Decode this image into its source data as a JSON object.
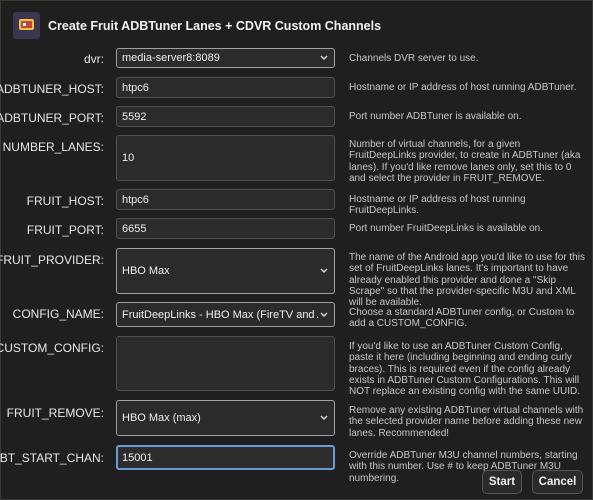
{
  "window": {
    "title": "Create Fruit ADBTuner Lanes + CDVR Custom Channels"
  },
  "fields": [
    {
      "label": "dvr:",
      "value": "media-server8:8089",
      "type": "select",
      "desc": "Channels DVR server to use."
    },
    {
      "label": "ADBTUNER_HOST:",
      "value": "htpc6",
      "type": "text",
      "desc": "Hostname or IP address of host running ADBTuner."
    },
    {
      "label": "ADBTUNER_PORT:",
      "value": "5592",
      "type": "text",
      "desc": "Port number ADBTuner is available on."
    },
    {
      "label": "NUMBER_LANES:",
      "value": "10",
      "type": "text",
      "desc": "Number of virtual channels, for a given FruitDeepLinks provider, to create in ADBTuner (aka lanes). If you'd like remove lanes only, set this to 0 and select the provider in FRUIT_REMOVE."
    },
    {
      "label": "FRUIT_HOST:",
      "value": "htpc6",
      "type": "text",
      "desc": "Hostname or IP address of host running FruitDeepLinks."
    },
    {
      "label": "FRUIT_PORT:",
      "value": "6655",
      "type": "text",
      "desc": "Port number FruitDeepLinks is available on."
    },
    {
      "label": "FRUIT_PROVIDER:",
      "value": "HBO Max",
      "type": "select",
      "desc": "The name of the Android app you'd like to use for this set of FruitDeepLinks lanes. It's important to have already enabled this provider and done a \"Skip Scrape\" so that the provider-specific M3U and XML will be available."
    },
    {
      "label": "CONFIG_NAME:",
      "value": "FruitDeepLinks - HBO Max (FireTV and AndroidTV)",
      "type": "select",
      "desc": "Choose a standard ADBTuner config, or Custom to add a CUSTOM_CONFIG."
    },
    {
      "label": "CUSTOM_CONFIG:",
      "value": "",
      "type": "textarea",
      "desc": "If you'd like to use an ADBTuner Custom Config, paste it here (including beginning and ending curly braces). This is required even if the config already exists in ADBTuner Custom Configurations. This will NOT replace an existing config with the same UUID."
    },
    {
      "label": "FRUIT_REMOVE:",
      "value": "HBO Max (max)",
      "type": "select",
      "desc": "Remove any existing ADBTuner virtual channels with the selected provider name before adding these new lanes. Recommended!"
    },
    {
      "label": "ADBT_START_CHAN:",
      "value": "15001",
      "type": "text",
      "desc": "Override ADBTuner M3U channel numbers, starting with this number. Use # to keep ADBTuner M3U numbering."
    }
  ],
  "buttons": {
    "start": "Start",
    "cancel": "Cancel"
  }
}
